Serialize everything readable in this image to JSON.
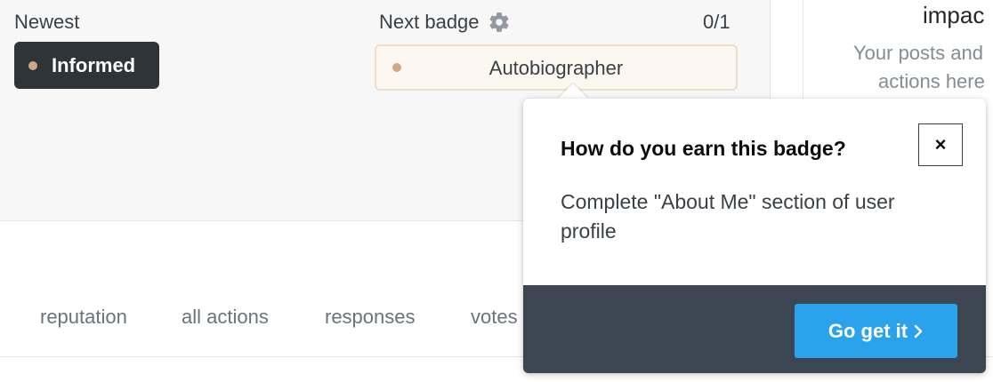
{
  "badges": {
    "newest_label": "Newest",
    "newest_badge": "Informed",
    "next_label": "Next badge",
    "next_badge": "Autobiographer",
    "progress": "0/1",
    "bronze_color": "#d1a684"
  },
  "impact": {
    "title": "impac",
    "desc_line1": "Your posts and",
    "desc_line2": "actions here"
  },
  "tabs": [
    {
      "label": "reputation"
    },
    {
      "label": "all actions"
    },
    {
      "label": "responses"
    },
    {
      "label": "votes"
    }
  ],
  "popover": {
    "title": "How do you earn this badge?",
    "close_label": "×",
    "description": "Complete \"About Me\" section of user profile",
    "button_label": "Go get it",
    "button_color": "#2ba3ec",
    "footer_color": "#3d4653"
  }
}
